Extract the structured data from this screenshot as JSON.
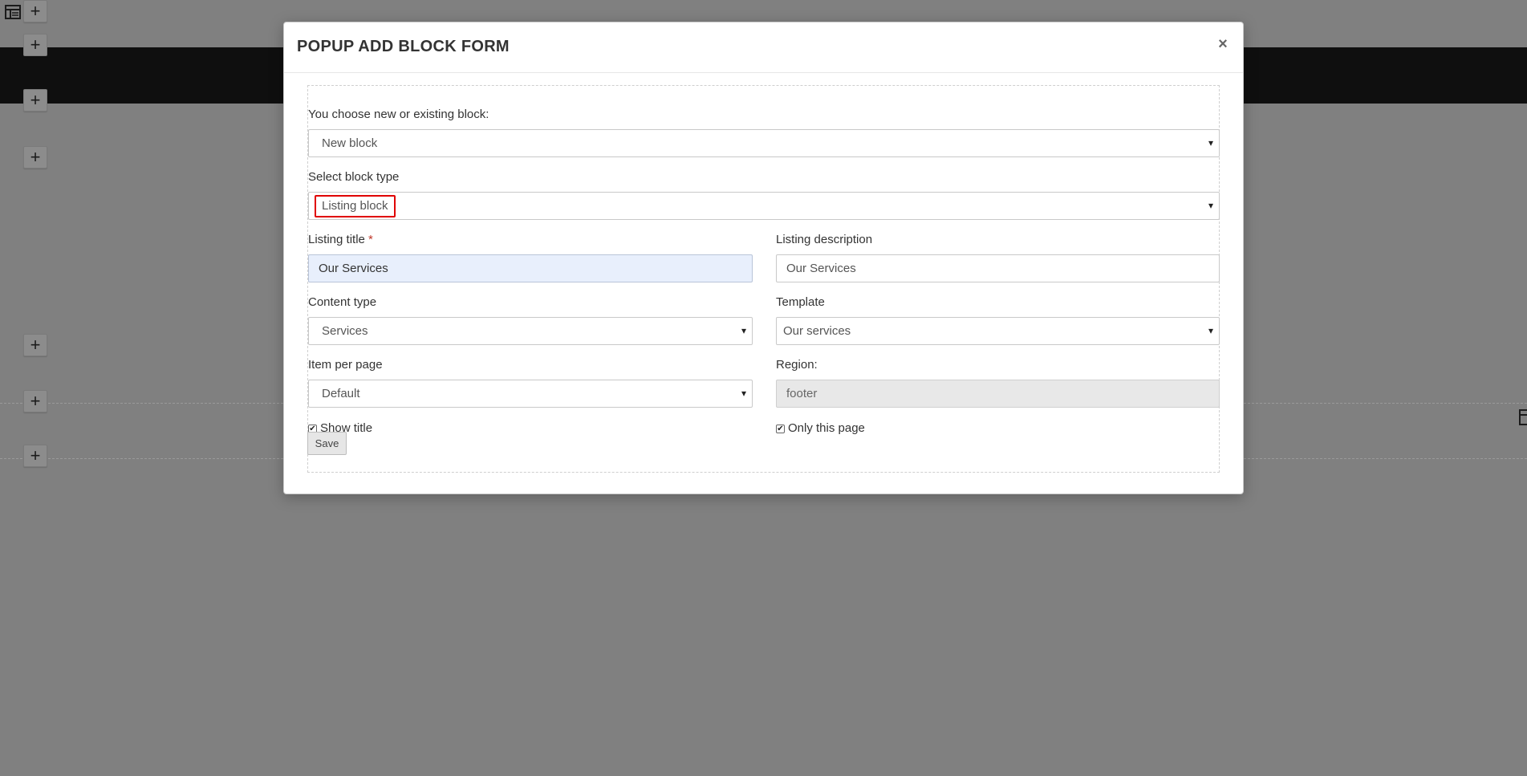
{
  "background": {
    "plus_buttons": [
      "+",
      "+",
      "+",
      "+",
      "+",
      "+",
      "+"
    ]
  },
  "modal": {
    "title": "POPUP ADD BLOCK FORM",
    "close_label": "×",
    "choose_block": {
      "label": "You choose new or existing block:",
      "value": "New block"
    },
    "block_type": {
      "label": "Select block type",
      "value": "Listing block"
    },
    "listing_title": {
      "label": "Listing title",
      "required_mark": "*",
      "value": "Our Services"
    },
    "listing_description": {
      "label": "Listing description",
      "value": "Our Services"
    },
    "content_type": {
      "label": "Content type",
      "value": "Services"
    },
    "template": {
      "label": "Template",
      "value": "Our services"
    },
    "item_per_page": {
      "label": "Item per page",
      "value": "Default"
    },
    "region": {
      "label": "Region:",
      "value": "footer"
    },
    "show_title": {
      "label": "Show title",
      "checked": true
    },
    "only_this_page": {
      "label": "Only this page",
      "checked": true
    },
    "save_label": "Save"
  },
  "colors": {
    "overlay": "#808080",
    "highlight": "#e00000",
    "required": "#c0392b"
  }
}
